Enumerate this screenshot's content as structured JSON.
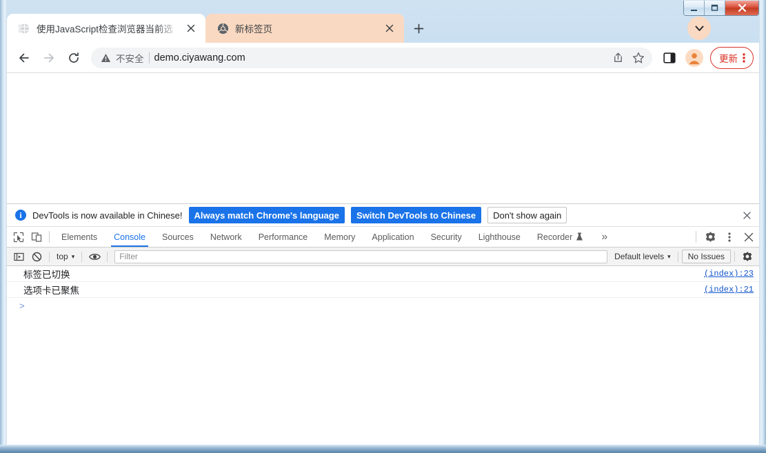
{
  "window": {
    "controls": {
      "minimize": "minimize",
      "maximize": "maximize",
      "close": "close"
    }
  },
  "tabstrip": {
    "tabs": [
      {
        "title": "使用JavaScript检查浏览器当前选",
        "favicon": "globe-icon",
        "active": true,
        "close_label": "×"
      },
      {
        "title": "新标签页",
        "favicon": "chrome-icon",
        "active": false,
        "close_label": "×"
      }
    ],
    "new_tab_label": "+",
    "tab_search_icon": "chevron-down-icon"
  },
  "toolbar": {
    "back_icon": "back-arrow-icon",
    "forward_icon": "forward-arrow-icon",
    "reload_icon": "reload-icon",
    "omnibox": {
      "security_icon": "warning-triangle-icon",
      "security_text": "不安全",
      "url": "demo.ciyawang.com",
      "share_icon": "share-icon",
      "bookmark_icon": "star-icon"
    },
    "side_panel_icon": "side-panel-icon",
    "profile_icon": "profile-avatar-icon",
    "update_label": "更新",
    "menu_icon": "kebab-menu-icon"
  },
  "devtools": {
    "infobar": {
      "icon": "info-icon",
      "message": "DevTools is now available in Chinese!",
      "buttons": [
        {
          "label": "Always match Chrome's language",
          "style": "primary"
        },
        {
          "label": "Switch DevTools to Chinese",
          "style": "primary"
        },
        {
          "label": "Don't show again",
          "style": "secondary"
        }
      ],
      "close_label": "×"
    },
    "panel_tabs": [
      {
        "label": "Elements",
        "active": false
      },
      {
        "label": "Console",
        "active": true
      },
      {
        "label": "Sources",
        "active": false
      },
      {
        "label": "Network",
        "active": false
      },
      {
        "label": "Performance",
        "active": false
      },
      {
        "label": "Memory",
        "active": false
      },
      {
        "label": "Application",
        "active": false
      },
      {
        "label": "Security",
        "active": false
      },
      {
        "label": "Lighthouse",
        "active": false
      },
      {
        "label": "Recorder",
        "active": false,
        "icon": "flask-icon"
      }
    ],
    "tabbar_icons": {
      "inspect": "inspect-element-icon",
      "device": "device-toolbar-icon",
      "more_tabs": "»",
      "settings": "gear-icon",
      "more": "kebab-menu-icon",
      "close": "close-icon"
    },
    "console_toolbar": {
      "sidebar_icon": "console-sidebar-icon",
      "clear_icon": "clear-console-icon",
      "context": "top",
      "context_caret": "▾",
      "eye_icon": "live-expression-icon",
      "filter_placeholder": "Filter",
      "levels": "Default levels",
      "levels_caret": "▾",
      "issues": "No Issues",
      "settings_icon": "gear-icon"
    },
    "console_logs": [
      {
        "message": "标签已切换",
        "source": "(index):23"
      },
      {
        "message": "选项卡已聚焦",
        "source": "(index):21"
      }
    ],
    "prompt": ">"
  },
  "colors": {
    "accent_blue": "#1a73e8",
    "link_blue": "#1155cc",
    "update_red": "#d93025",
    "inactive_tab": "#fad9c2",
    "profile_orange": "#e8833a",
    "frame_blue": "#bcd8ee"
  }
}
